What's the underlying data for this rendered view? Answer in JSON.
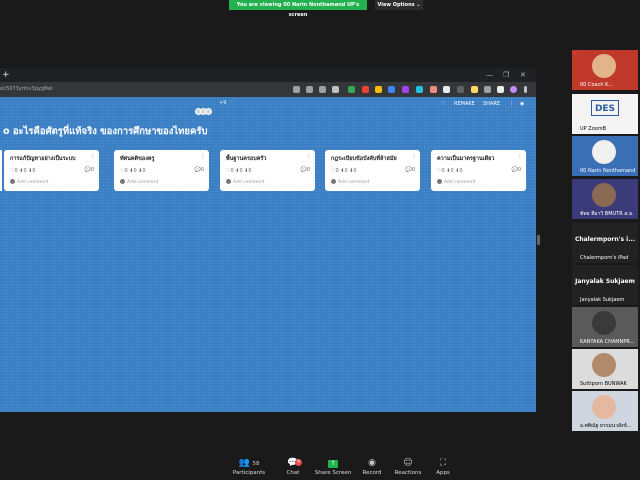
{
  "banner": {
    "viewing": "You are viewing 00 Narin Nonthamand UP's screen",
    "view_options": "View Options ⌄"
  },
  "browser": {
    "url": "ol/5073yrlnv3pyg8wi",
    "new_tab": "+",
    "window_controls": [
      "—",
      "❐",
      "✕"
    ]
  },
  "padlet": {
    "title": "o อะไรคือศัตรูที่แท้จริง ของการศึกษาของไทยครับ",
    "visitor_count": "+9 ⋰",
    "actions": {
      "remake": "REMAKE",
      "share": "SHARE"
    },
    "cards": [
      {
        "title": "การแก้ปัญหาอย่างเป็นระบบ",
        "reactions": "♡0 ⬆0 ⬇0",
        "comments": "0",
        "add_comment": "Add comment"
      },
      {
        "title": "ทัศนคติของครู",
        "reactions": "♡0 ⬆0 ⬇0",
        "comments": "0",
        "add_comment": "Add comment"
      },
      {
        "title": "พื้นฐานครอบครัว",
        "reactions": "♡0 ⬆0 ⬇0",
        "comments": "0",
        "add_comment": "Add comment"
      },
      {
        "title": "กฎระเบียบข้อบังคับที่ล้าสมัย",
        "reactions": "♡0 ⬆0 ⬇0",
        "comments": "0",
        "add_comment": "Add comment"
      },
      {
        "title": "ความเป็นมาตรฐานเดียว",
        "reactions": "♡0 ⬆0 ⬇0",
        "comments": "0",
        "add_comment": "Add comment"
      }
    ],
    "fab_label": "+"
  },
  "participants": [
    {
      "label": "00 Coach K..."
    },
    {
      "label": "UP ZoomB"
    },
    {
      "label": "00 Narin Nonthamand"
    },
    {
      "label": "พัทธ สีมาวิ BMUTR ส.ม."
    },
    {
      "name": "Chalermporn's i...",
      "label": "Chalermporn's iPad"
    },
    {
      "name": "Janyalak Sukjaem",
      "label": "Janyalak Sukjaem"
    },
    {
      "label": "KANYAKA CHAMNPR..."
    },
    {
      "label": "Suttiporn BUNWAK"
    },
    {
      "label": "อ.ศศิณัฐ ธรรมนวสังข์..."
    }
  ],
  "toolbar": {
    "participants": {
      "label": "Participants",
      "count": "58"
    },
    "chat": {
      "label": "Chat",
      "badge": "9"
    },
    "share": {
      "label": "Share Screen"
    },
    "record": {
      "label": "Record"
    },
    "reactions": {
      "label": "Reactions"
    },
    "apps": {
      "label": "Apps"
    }
  },
  "colors": {
    "banner": "#22b14c",
    "board": "#3a7fc4",
    "fab": "#e91e63"
  }
}
